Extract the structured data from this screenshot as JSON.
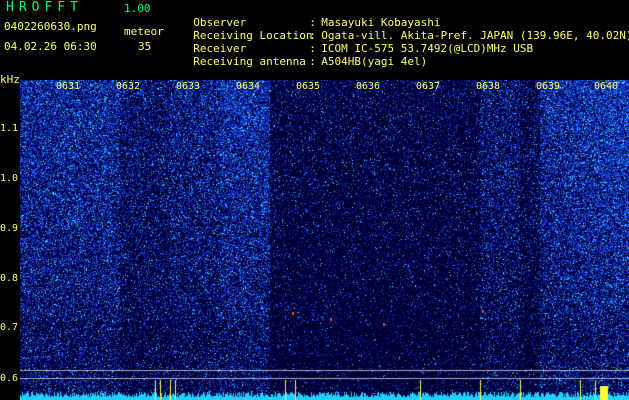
{
  "app": {
    "title": "HROFFT",
    "version": "1.00"
  },
  "file_name": "0402260630.png",
  "datetime": "04.02.26 06:30",
  "meteor": {
    "label": "meteor",
    "count": "35"
  },
  "info": [
    {
      "key": "Observer",
      "value": "Masayuki Kobayashi"
    },
    {
      "key": "Receiving Location",
      "value": "Ogata-vill. Akita-Pref. JAPAN (139.96E, 40.02N)"
    },
    {
      "key": "Receiver",
      "value": "ICOM IC-575 53.7492(@LCD)MHz USB"
    },
    {
      "key": "Receiving antenna",
      "value": "A504HB(yagi 4el)"
    }
  ],
  "spectrogram": {
    "y_axis_label": "kHz",
    "y_ticks": [
      "1.1",
      "1.0",
      "0.9",
      "0.8",
      "0.7",
      "0.6"
    ],
    "x_ticks": [
      "0631",
      "0632",
      "0633",
      "0634",
      "0635",
      "0636",
      "0637",
      "0638",
      "0639",
      "0640"
    ],
    "colors": {
      "background": "#000000",
      "noise": "#1a3cff",
      "signal": "#00ffff",
      "tick": "#ffff66",
      "echo": "#ff4444"
    }
  }
}
